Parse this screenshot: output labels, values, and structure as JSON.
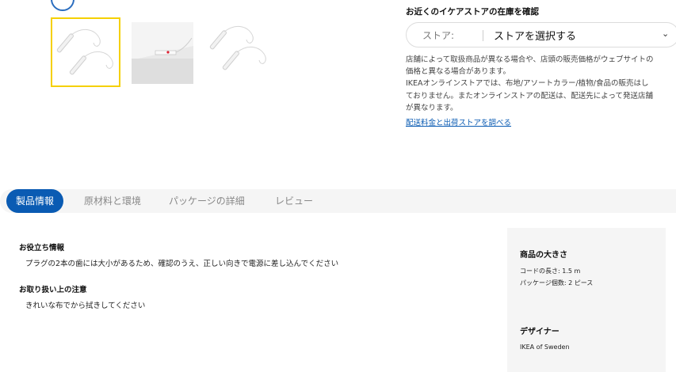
{
  "gallery": {
    "thumbnails": [
      {
        "name": "thumb-product-front",
        "selected": true
      },
      {
        "name": "thumb-product-in-use",
        "selected": false
      },
      {
        "name": "thumb-product-alt",
        "selected": false
      }
    ]
  },
  "store": {
    "title": "お近くのイケアストアの在庫を確認",
    "select_label": "ストア:",
    "select_value": "ストアを選択する",
    "chevron": "⌄",
    "note": "店舗によって取扱商品が異なる場合や、店頭の販売価格がウェブサイトの\n価格と異なる場合があります。\nIKEAオンラインストアでは、布地/アソートカラー/植物/食品の販売はし\nておりません。またオンラインストアの配送は、配送先によって発送店舗\nが異なります。",
    "link": "配送料金と出荷ストアを調べる"
  },
  "tabs": [
    {
      "label": "製品情報",
      "active": true
    },
    {
      "label": "原材料と環境",
      "active": false
    },
    {
      "label": "パッケージの詳細",
      "active": false
    },
    {
      "label": "レビュー",
      "active": false
    }
  ],
  "product_info": {
    "useful_title": "お役立ち情報",
    "useful_text": "プラグの2本の歯には大小があるため、確認のうえ、正しい向きで電源に差し込んでください",
    "care_title": "お取り扱い上の注意",
    "care_text": "きれいな布でから拭きしてください"
  },
  "dimensions": {
    "title": "商品の大きさ",
    "cord_length": "コードの長さ: 1.5 m",
    "package_count": "パッケージ個数: 2 ピース",
    "designer_title": "デザイナー",
    "designer_name": "IKEA of Sweden"
  },
  "colors": {
    "accent": "#0a5bb3",
    "selected_border": "#f5d000"
  }
}
